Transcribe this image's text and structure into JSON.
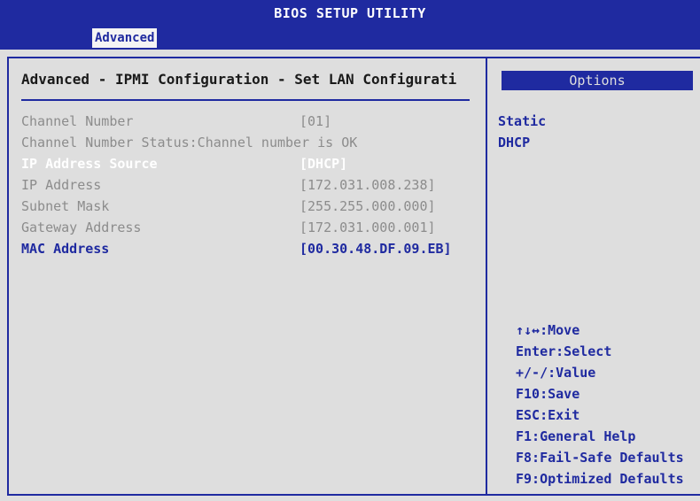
{
  "title": "BIOS SETUP UTILITY",
  "active_tab": "Advanced",
  "header": "Advanced - IPMI Configuration - Set LAN Configurati",
  "rows": [
    {
      "label": "Channel Number",
      "value": "[01]"
    },
    {
      "label": "Channel Number Status:Channel number is OK",
      "value": ""
    },
    {
      "label": "IP Address Source",
      "value": "[DHCP]"
    },
    {
      "label": "IP Address",
      "value": "[172.031.008.238]"
    },
    {
      "label": "Subnet Mask",
      "value": "[255.255.000.000]"
    },
    {
      "label": "Gateway Address",
      "value": "[172.031.000.001]"
    },
    {
      "label": "MAC Address",
      "value": "[00.30.48.DF.09.EB]"
    }
  ],
  "options": {
    "title": "Options",
    "items": [
      "Static",
      "DHCP"
    ]
  },
  "help": [
    "↑↓↔:Move",
    "Enter:Select",
    "+/-/:Value",
    "F10:Save",
    "ESC:Exit",
    "F1:General Help",
    "F8:Fail-Safe Defaults",
    "F9:Optimized Defaults"
  ],
  "colors": {
    "accent": "#1f2aa0",
    "background": "#dedede",
    "disabled_text": "#8c8c8c",
    "selected_text": "#ffffff"
  }
}
